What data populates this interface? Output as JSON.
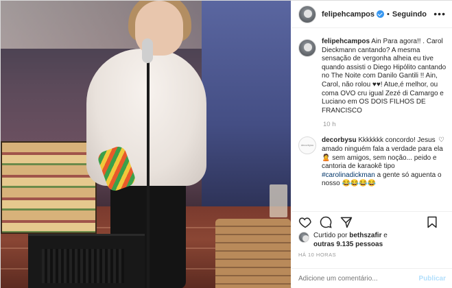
{
  "post": {
    "author": "felipehcampos",
    "follow_separator": "•",
    "follow_label": "Seguindo",
    "more_label": "•••",
    "caption_author": "felipehcampos",
    "caption": "Ain Para agora!! . Carol Dieckmann cantando? A mesma sensação de vergonha alheia eu tive quando assisti o Diego Hipólito cantando no The Noite com Danilo Gantili !! Ain, Carol, não rolou ♥♥! Atue,é melhor, ou coma OVO cru igual Zezé di Camargo e Luciano em OS DOIS FILHOS DE FRANCISCO",
    "caption_time": "10 h",
    "comments": [
      {
        "author": "decorbysu",
        "avatar_text": "decorbysu",
        "text_before_tag": "Kkkkkkk concordo! Jesus amado ninguém fala a verdade para ela 🙎 sem amigos, sem noção... peido e cantoria de karaokê tipo ",
        "hashtag": "#carolinadickman",
        "text_after_tag": " a gente só aguenta o nosso 😂😂😂😂"
      }
    ],
    "likes_prefix": "Curtido por ",
    "likes_user": "bethszafir",
    "likes_mid": " e",
    "likes_others": "outras 9.135 pessoas",
    "time_ago": "HÁ 10 HORAS",
    "add_comment_placeholder": "Adicione um comentário...",
    "publish_label": "Publicar"
  },
  "icons": [
    "heart-icon",
    "comment-icon",
    "share-icon",
    "bookmark-icon"
  ],
  "colors": {
    "verified": "#3897f0",
    "publish_disabled": "#b2dffc",
    "hashtag": "#003569"
  }
}
